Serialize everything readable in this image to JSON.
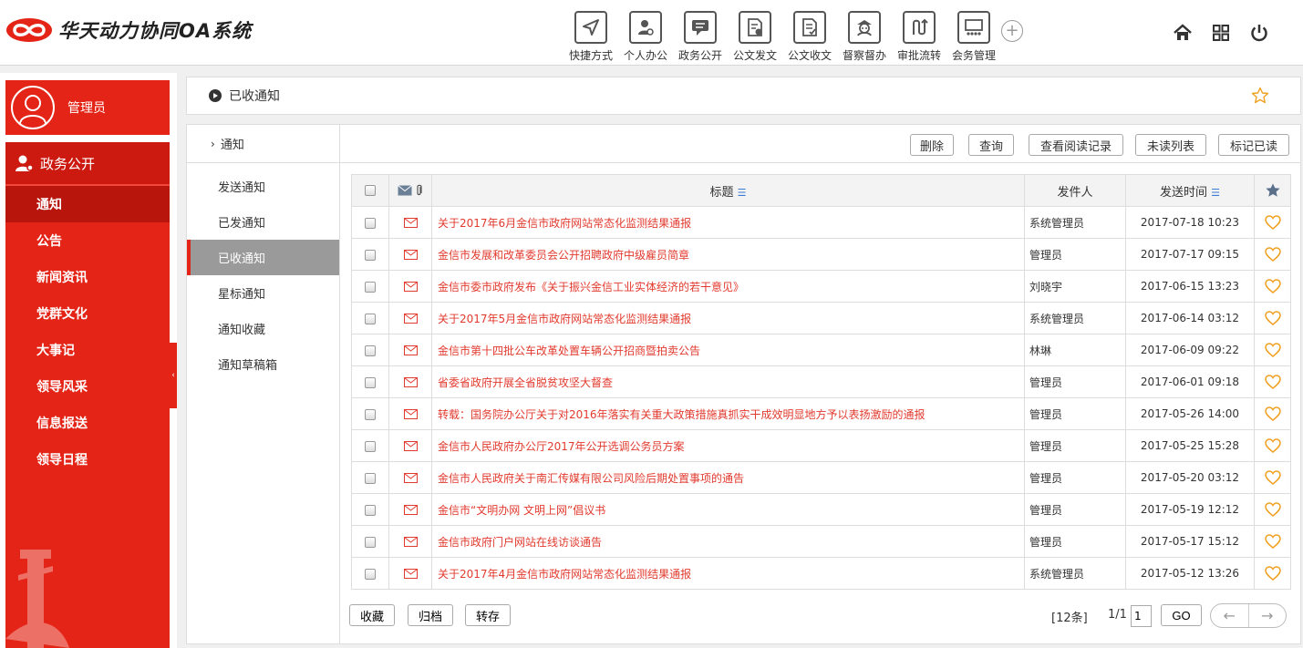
{
  "app": {
    "title": "华天动力协同OA系统",
    "brand_color": "#e42416"
  },
  "topnav": {
    "items": [
      {
        "label": "快捷方式",
        "icon": "send-icon"
      },
      {
        "label": "个人办公",
        "icon": "person-icon"
      },
      {
        "label": "政务公开",
        "icon": "chat-icon"
      },
      {
        "label": "公文发文",
        "icon": "document-send-icon"
      },
      {
        "label": "公文收文",
        "icon": "document-check-icon"
      },
      {
        "label": "督察督办",
        "icon": "inspector-icon"
      },
      {
        "label": "审批流转",
        "icon": "flow-icon"
      },
      {
        "label": "会务管理",
        "icon": "meeting-icon"
      }
    ],
    "right_icons": [
      "home-icon",
      "grid-icon",
      "power-icon"
    ]
  },
  "sidebar": {
    "user_name": "管理员",
    "section": "政务公开",
    "items": [
      {
        "label": "通知",
        "active": true
      },
      {
        "label": "公告",
        "active": false
      },
      {
        "label": "新闻资讯",
        "active": false
      },
      {
        "label": "党群文化",
        "active": false
      },
      {
        "label": "大事记",
        "active": false
      },
      {
        "label": "领导风采",
        "active": false
      },
      {
        "label": "信息报送",
        "active": false
      },
      {
        "label": "领导日程",
        "active": false
      }
    ]
  },
  "breadcrumb": {
    "text": "已收通知"
  },
  "subnav": {
    "head": "通知",
    "items": [
      {
        "label": "发送通知",
        "active": false
      },
      {
        "label": "已发通知",
        "active": false
      },
      {
        "label": "已收通知",
        "active": true
      },
      {
        "label": "星标通知",
        "active": false
      },
      {
        "label": "通知收藏",
        "active": false
      },
      {
        "label": "通知草稿箱",
        "active": false
      }
    ]
  },
  "toolbar": {
    "delete": "删除",
    "query": "查询",
    "read_log": "查看阅读记录",
    "unread_list": "未读列表",
    "mark_read": "标记已读"
  },
  "table": {
    "columns": {
      "title": "标题",
      "sender": "发件人",
      "time": "发送时间"
    },
    "rows": [
      {
        "title": "关于2017年6月金信市政府网站常态化监测结果通报",
        "sender": "系统管理员",
        "time": "2017-07-18 10:23"
      },
      {
        "title": "金信市发展和改革委员会公开招聘政府中级雇员简章",
        "sender": "管理员",
        "time": "2017-07-17 09:15"
      },
      {
        "title": "金信市委市政府发布《关于振兴金信工业实体经济的若干意见》",
        "sender": "刘晓宇",
        "time": "2017-06-15 13:23"
      },
      {
        "title": "关于2017年5月金信市政府网站常态化监测结果通报",
        "sender": "系统管理员",
        "time": "2017-06-14 03:12"
      },
      {
        "title": "金信市第十四批公车改革处置车辆公开招商暨拍卖公告",
        "sender": "林琳",
        "time": "2017-06-09 09:22"
      },
      {
        "title": "省委省政府开展全省脱贫攻坚大督查",
        "sender": "管理员",
        "time": "2017-06-01 09:18"
      },
      {
        "title": "转载：国务院办公厅关于对2016年落实有关重大政策措施真抓实干成效明显地方予以表扬激励的通报",
        "sender": "管理员",
        "time": "2017-05-26 14:00"
      },
      {
        "title": "金信市人民政府办公厅2017年公开选调公务员方案",
        "sender": "管理员",
        "time": "2017-05-25 15:28"
      },
      {
        "title": "金信市人民政府关于南汇传媒有限公司风险后期处置事项的通告",
        "sender": "管理员",
        "time": "2017-05-20 03:12"
      },
      {
        "title": "金信市“文明办网 文明上网”倡议书",
        "sender": "管理员",
        "time": "2017-05-19 12:12"
      },
      {
        "title": "金信市政府门户网站在线访谈通告",
        "sender": "管理员",
        "time": "2017-05-17 15:12"
      },
      {
        "title": "关于2017年4月金信市政府网站常态化监测结果通报",
        "sender": "系统管理员",
        "time": "2017-05-12 13:26"
      }
    ]
  },
  "bottom": {
    "favorite": "收藏",
    "archive": "归档",
    "forward": "转存"
  },
  "pager": {
    "count": "[12条]",
    "page": "1/1",
    "input_value": "1",
    "go": "GO"
  }
}
